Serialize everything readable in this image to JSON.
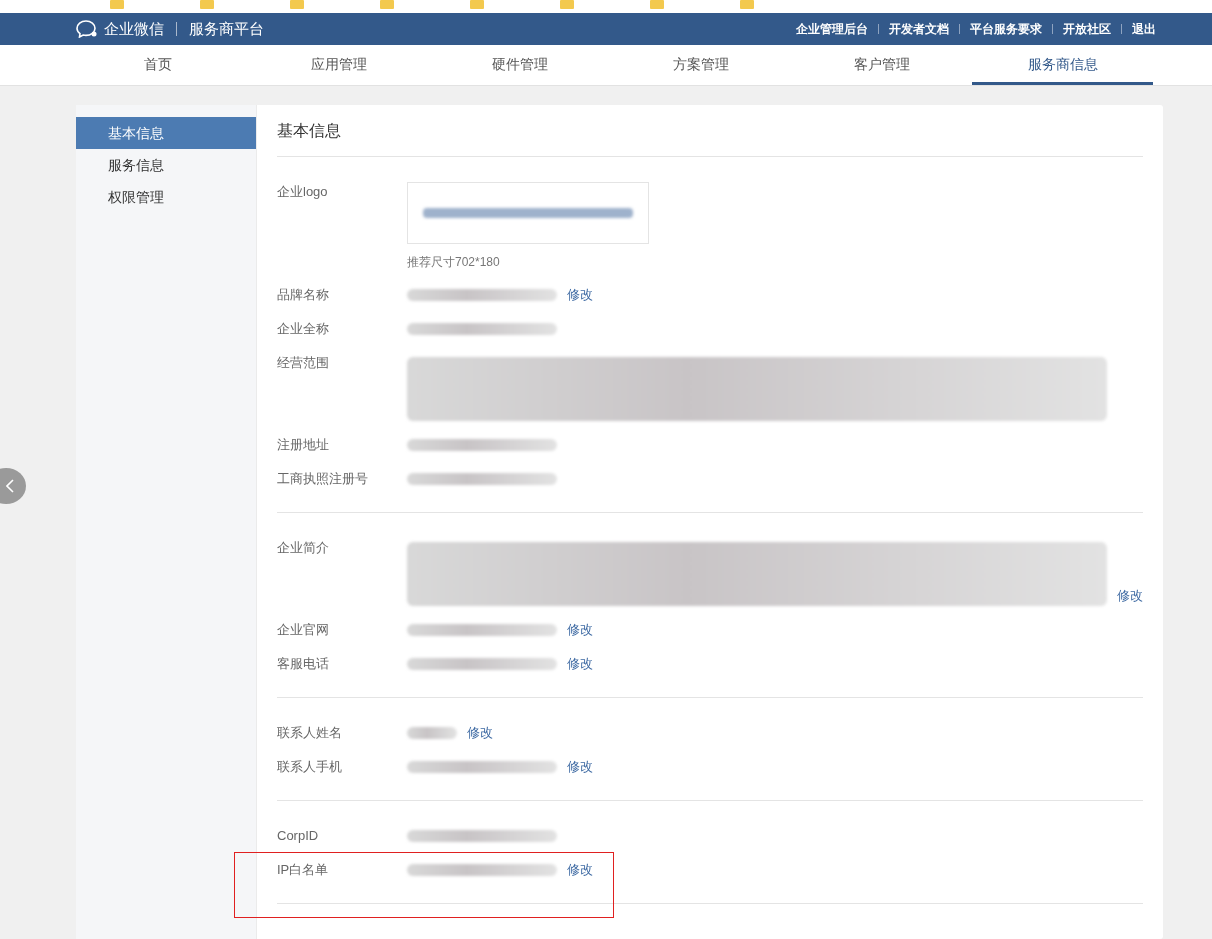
{
  "header": {
    "logo_text": "企业微信",
    "platform": "服务商平台",
    "links": [
      "企业管理后台",
      "开发者文档",
      "平台服务要求",
      "开放社区",
      "退出"
    ]
  },
  "tabs": [
    {
      "label": "首页",
      "selected": false
    },
    {
      "label": "应用管理",
      "selected": false
    },
    {
      "label": "硬件管理",
      "selected": false
    },
    {
      "label": "方案管理",
      "selected": false
    },
    {
      "label": "客户管理",
      "selected": false
    },
    {
      "label": "服务商信息",
      "selected": true
    }
  ],
  "sidebar": {
    "items": [
      {
        "label": "基本信息",
        "selected": true
      },
      {
        "label": "服务信息",
        "selected": false
      },
      {
        "label": "权限管理",
        "selected": false
      }
    ]
  },
  "content": {
    "title": "基本信息",
    "sections": [
      {
        "fields": [
          {
            "label": "企业logo",
            "kind": "logo",
            "hint": "推荐尺寸702*180"
          },
          {
            "label": "品牌名称",
            "kind": "line",
            "edit": "修改"
          },
          {
            "label": "企业全称",
            "kind": "line"
          },
          {
            "label": "经营范围",
            "kind": "paragraph"
          },
          {
            "label": "注册地址",
            "kind": "line"
          },
          {
            "label": "工商执照注册号",
            "kind": "line"
          }
        ]
      },
      {
        "fields": [
          {
            "label": "企业简介",
            "kind": "paragraph",
            "edit": "修改"
          },
          {
            "label": "企业官网",
            "kind": "line",
            "edit": "修改"
          },
          {
            "label": "客服电话",
            "kind": "line",
            "edit": "修改"
          }
        ]
      },
      {
        "fields": [
          {
            "label": "联系人姓名",
            "kind": "short",
            "edit": "修改"
          },
          {
            "label": "联系人手机",
            "kind": "line",
            "edit": "修改"
          }
        ]
      },
      {
        "fields": [
          {
            "label": "CorpID",
            "kind": "line"
          },
          {
            "label": "IP白名单",
            "kind": "line",
            "edit": "修改",
            "highlighted": true
          }
        ]
      }
    ]
  }
}
